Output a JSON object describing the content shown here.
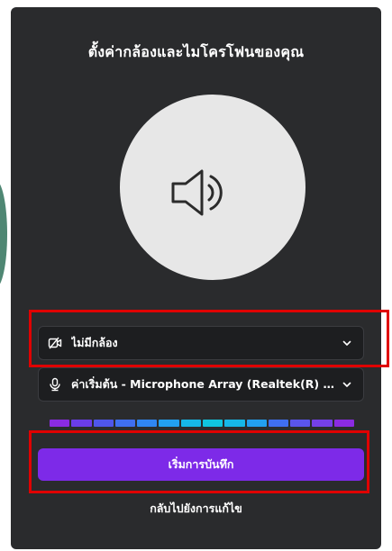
{
  "dialog": {
    "title": "ตั้งค่ากล้องและไมโครโฟนของคุณ"
  },
  "preview": {
    "icon": "speaker-icon"
  },
  "camera_select": {
    "icon": "camera-off-icon",
    "value": "ไม่มีกล้อง"
  },
  "mic_select": {
    "icon": "microphone-icon",
    "value": "ค่าเริ่มต้น - Microphone Array (Realtek(R) Audi..."
  },
  "audio_meter": {
    "segments": 14,
    "colors": [
      "#8a2be2",
      "#6a3de8",
      "#4f56ea",
      "#3f6ff0",
      "#2f86f2",
      "#22a0f0",
      "#16b8e8",
      "#10c6e0",
      "#16b8e8",
      "#22a0f0",
      "#3f6ff0",
      "#5a55ec",
      "#7440e8",
      "#8a2be2"
    ]
  },
  "start_button": {
    "label": "เริ่มการบันทึก"
  },
  "back_link": {
    "label": "กลับไปยังการแก้ไข"
  },
  "colors": {
    "panel_bg": "#2a2b2d",
    "accent": "#7d2ae8",
    "highlight": "#e00000"
  }
}
